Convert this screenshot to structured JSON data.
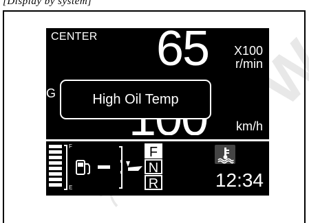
{
  "caption": "[Display by system]",
  "display": {
    "mode": "CENTER",
    "rpm": {
      "value": "65",
      "multiplier": "X100",
      "unit": "r/min"
    },
    "speed": {
      "value": "100",
      "unit": "km/h",
      "partial_label": "G"
    },
    "alert": {
      "message": "High Oil Temp"
    },
    "fuel": {
      "full_label": "F",
      "empty_label": "E",
      "level_fraction": 0.8,
      "icon": "fuel-pump-icon"
    },
    "trim": {
      "icon": "trim-indicator-icon"
    },
    "gear": {
      "options": [
        "F",
        "N",
        "R"
      ],
      "selected": "F"
    },
    "coolant": {
      "icon": "coolant-temperature-icon"
    },
    "clock": "12:34"
  },
  "colors": {
    "screen_bg": "#000000",
    "foreground": "#ffffff"
  }
}
